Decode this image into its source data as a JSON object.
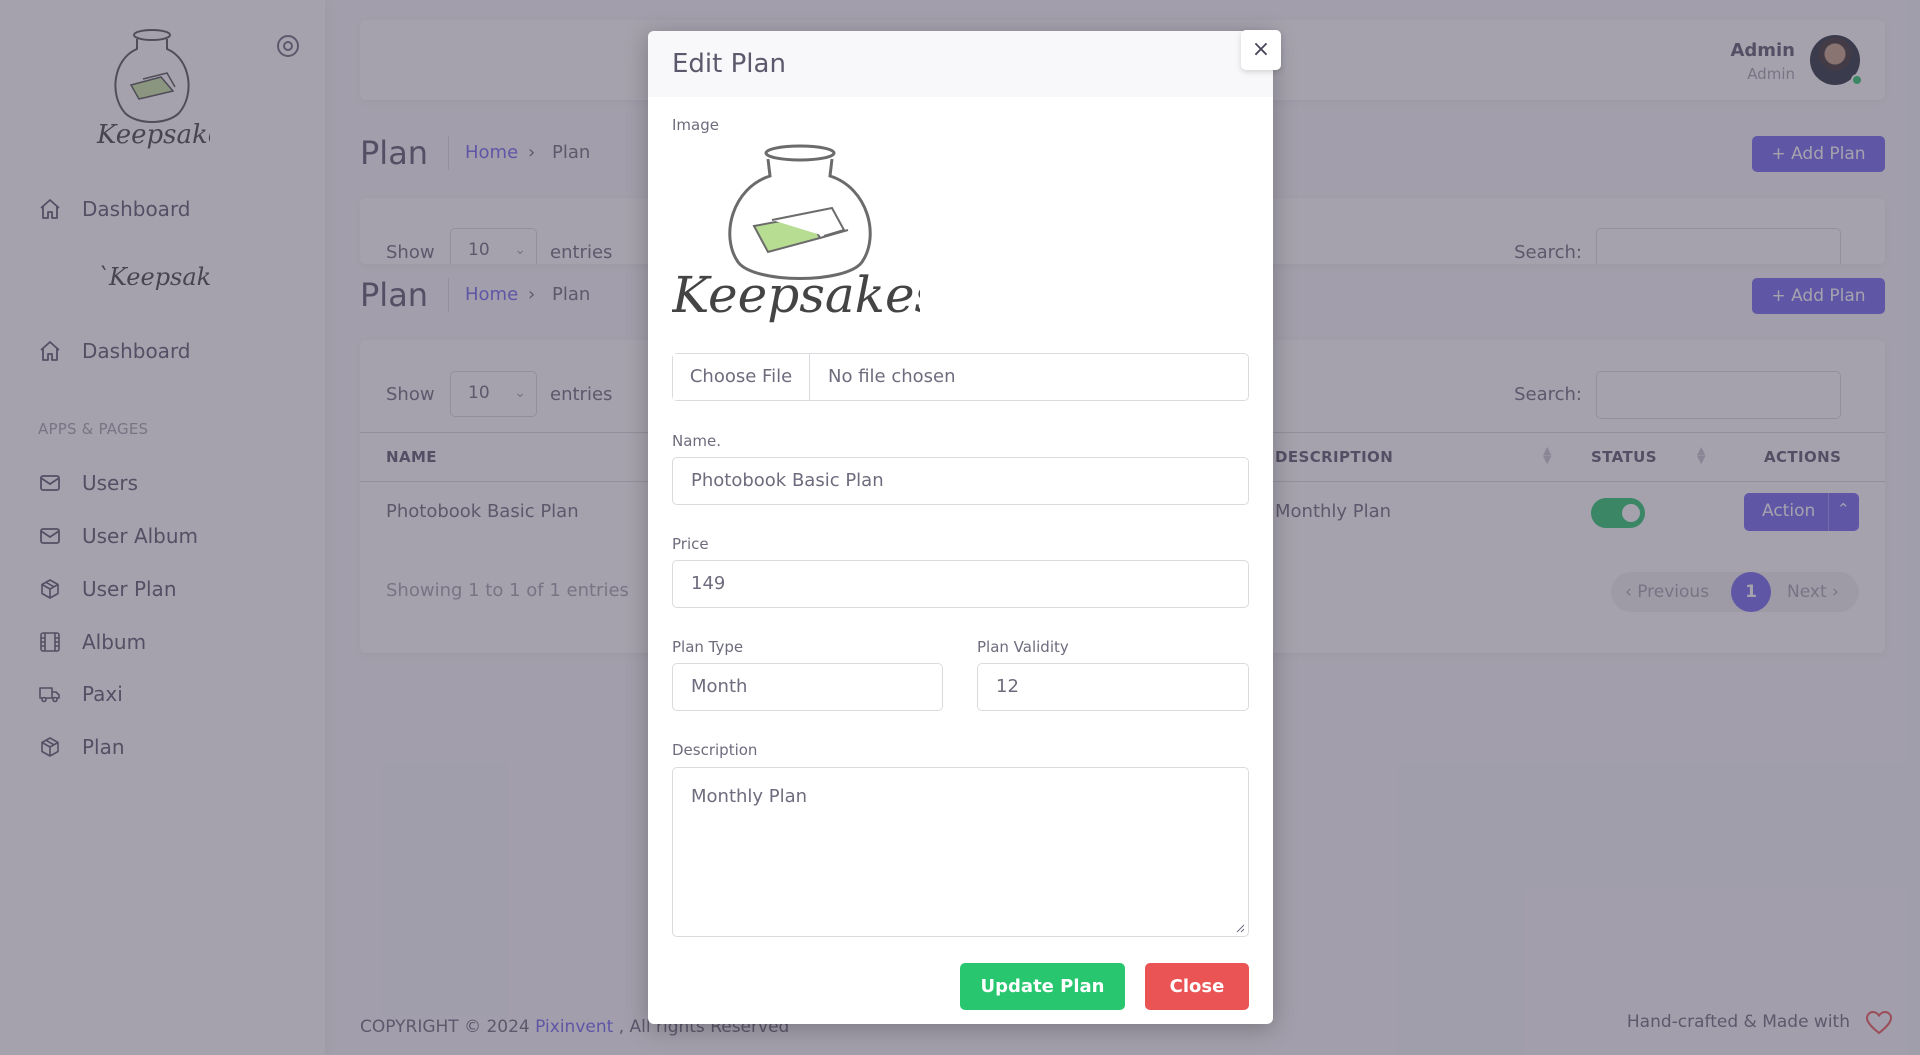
{
  "sidebar": {
    "logo_text": "Keepsakes",
    "menu_top": [
      {
        "label": "Dashboard"
      },
      {
        "label": "Dashboard"
      }
    ],
    "section_label": "APPS & PAGES",
    "items": [
      {
        "label": "Users",
        "icon": "mail-icon"
      },
      {
        "label": "User Album",
        "icon": "mail-icon"
      },
      {
        "label": "User Plan",
        "icon": "box-icon"
      },
      {
        "label": "Album",
        "icon": "film-icon"
      },
      {
        "label": "Paxi",
        "icon": "truck-icon"
      },
      {
        "label": "Plan",
        "icon": "box-icon"
      }
    ]
  },
  "header": {
    "user_name": "Admin",
    "user_role": "Admin"
  },
  "page": {
    "title": "Plan",
    "breadcrumb_home": "Home",
    "breadcrumb_sep": "›",
    "breadcrumb_current": "Plan",
    "add_button": "+ Add Plan"
  },
  "table": {
    "show_label": "Show",
    "entries_value": "10",
    "entries_label": "entries",
    "search_label": "Search:",
    "columns": {
      "name": "NAME",
      "description": "DESCRIPTION",
      "status": "STATUS",
      "actions": "ACTIONS"
    },
    "rows": [
      {
        "name": "Photobook Basic Plan",
        "description": "Monthly Plan",
        "status_on": true,
        "action_label": "Action"
      }
    ],
    "showing_text": "Showing 1 to 1 of 1 entries",
    "pager": {
      "prev": "‹ Previous",
      "current": "1",
      "next": "Next ›"
    }
  },
  "footer": {
    "copyright": "COPYRIGHT © 2024",
    "link": "Pixinvent",
    "rights": ", All rights Reserved",
    "right_text": "Hand-crafted & Made with"
  },
  "modal": {
    "title": "Edit Plan",
    "close_icon": "×",
    "image_label": "Image",
    "image_alt_text": "Keepsakes",
    "file_button": "Choose File",
    "file_status": "No file chosen",
    "name_label": "Name.",
    "name_value": "Photobook Basic Plan",
    "price_label": "Price",
    "price_value": "149",
    "plan_type_label": "Plan Type",
    "plan_type_value": "Month",
    "plan_validity_label": "Plan Validity",
    "plan_validity_value": "12",
    "description_label": "Description",
    "description_value": "Monthly Plan",
    "update_button": "Update Plan",
    "close_button": "Close"
  },
  "colors": {
    "primary": "#7367f0",
    "success": "#28c76f",
    "danger": "#ea5455",
    "backdrop": "#4b465c"
  }
}
